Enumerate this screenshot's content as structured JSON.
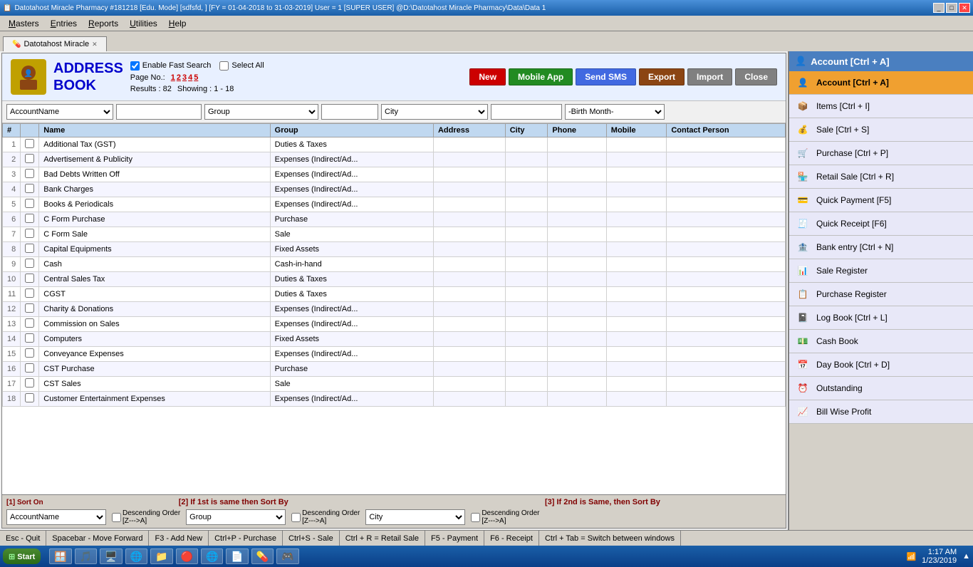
{
  "titlebar": {
    "title": "Datotahost Miracle Pharmacy #181218  [Edu. Mode]  [sdfsfd, ]  [FY = 01-04-2018 to 31-03-2019]  User = 1 [SUPER USER]  @D:\\Datotahost Miracle Pharmacy\\Data\\Data 1"
  },
  "menubar": {
    "items": [
      "Masters",
      "Entries",
      "Reports",
      "Utilities",
      "Help"
    ]
  },
  "tab": {
    "label": "Datotahost Miracle"
  },
  "addressbook": {
    "title_line1": "ADDRESS",
    "title_line2": "BOOK",
    "enable_fast_search": "Enable Fast Search",
    "select_all": "Select All",
    "page_no_label": "Page No.:",
    "pages": [
      "1",
      "2",
      "3",
      "4",
      "5"
    ],
    "results_label": "Results : 82",
    "showing_label": "Showing :  1 - 18",
    "buttons": {
      "new": "New",
      "mobile_app": "Mobile App",
      "send_sms": "Send SMS",
      "export": "Export",
      "import": "Import",
      "close": "Close"
    },
    "filters": {
      "account_name": "AccountName",
      "group": "Group",
      "city": "City",
      "birth_month": "-Birth Month-"
    },
    "columns": [
      "Name",
      "Group",
      "Address",
      "City",
      "Phone",
      "Mobile",
      "Contact Person"
    ],
    "rows": [
      {
        "num": "1",
        "name": "Additional Tax (GST)",
        "group": "Duties & Taxes",
        "address": "",
        "city": "",
        "phone": "",
        "mobile": "",
        "contact": ""
      },
      {
        "num": "2",
        "name": "Advertisement & Publicity",
        "group": "Expenses (Indirect/Ad...",
        "address": "",
        "city": "",
        "phone": "",
        "mobile": "",
        "contact": ""
      },
      {
        "num": "3",
        "name": "Bad Debts Written Off",
        "group": "Expenses (Indirect/Ad...",
        "address": "",
        "city": "",
        "phone": "",
        "mobile": "",
        "contact": ""
      },
      {
        "num": "4",
        "name": "Bank Charges",
        "group": "Expenses (Indirect/Ad...",
        "address": "",
        "city": "",
        "phone": "",
        "mobile": "",
        "contact": ""
      },
      {
        "num": "5",
        "name": "Books & Periodicals",
        "group": "Expenses (Indirect/Ad...",
        "address": "",
        "city": "",
        "phone": "",
        "mobile": "",
        "contact": ""
      },
      {
        "num": "6",
        "name": "C Form Purchase",
        "group": "Purchase",
        "address": "",
        "city": "",
        "phone": "",
        "mobile": "",
        "contact": ""
      },
      {
        "num": "7",
        "name": "C Form Sale",
        "group": "Sale",
        "address": "",
        "city": "",
        "phone": "",
        "mobile": "",
        "contact": ""
      },
      {
        "num": "8",
        "name": "Capital Equipments",
        "group": "Fixed Assets",
        "address": "",
        "city": "",
        "phone": "",
        "mobile": "",
        "contact": ""
      },
      {
        "num": "9",
        "name": "Cash",
        "group": "Cash-in-hand",
        "address": "",
        "city": "",
        "phone": "",
        "mobile": "",
        "contact": ""
      },
      {
        "num": "10",
        "name": "Central Sales Tax",
        "group": "Duties & Taxes",
        "address": "",
        "city": "",
        "phone": "",
        "mobile": "",
        "contact": ""
      },
      {
        "num": "11",
        "name": "CGST",
        "group": "Duties & Taxes",
        "address": "",
        "city": "",
        "phone": "",
        "mobile": "",
        "contact": ""
      },
      {
        "num": "12",
        "name": "Charity & Donations",
        "group": "Expenses (Indirect/Ad...",
        "address": "",
        "city": "",
        "phone": "",
        "mobile": "",
        "contact": ""
      },
      {
        "num": "13",
        "name": "Commission on Sales",
        "group": "Expenses (Indirect/Ad...",
        "address": "",
        "city": "",
        "phone": "",
        "mobile": "",
        "contact": ""
      },
      {
        "num": "14",
        "name": "Computers",
        "group": "Fixed Assets",
        "address": "",
        "city": "",
        "phone": "",
        "mobile": "",
        "contact": ""
      },
      {
        "num": "15",
        "name": "Conveyance Expenses",
        "group": "Expenses (Indirect/Ad...",
        "address": "",
        "city": "",
        "phone": "",
        "mobile": "",
        "contact": ""
      },
      {
        "num": "16",
        "name": "CST Purchase",
        "group": "Purchase",
        "address": "",
        "city": "",
        "phone": "",
        "mobile": "",
        "contact": ""
      },
      {
        "num": "17",
        "name": "CST Sales",
        "group": "Sale",
        "address": "",
        "city": "",
        "phone": "",
        "mobile": "",
        "contact": ""
      },
      {
        "num": "18",
        "name": "Customer Entertainment Expenses",
        "group": "Expenses (Indirect/Ad...",
        "address": "",
        "city": "",
        "phone": "",
        "mobile": "",
        "contact": ""
      }
    ]
  },
  "sort_bar": {
    "section1_label": "[1] Sort On",
    "section2_label": "[2] If 1st is same then Sort By",
    "section3_label": "[3] If 2nd is Same, then Sort By",
    "sort1_value": "AccountName",
    "sort2_value": "Group",
    "sort3_value": "City",
    "descending_label": "Descending Order [Z--->A]"
  },
  "statusbar": {
    "items": [
      "Esc - Quit",
      "Spacebar - Move Forward",
      "F3 - Add New",
      "Ctrl+P - Purchase",
      "Ctrl+S - Sale",
      "Ctrl + R = Retail Sale",
      "F5 - Payment",
      "F6 - Receipt",
      "Ctrl + Tab = Switch between windows"
    ]
  },
  "sidebar": {
    "header": "Account [Ctrl + A]",
    "items": [
      {
        "label": "Account [Ctrl + A]",
        "active": true,
        "icon": "account-icon"
      },
      {
        "label": "Items [Ctrl + I]",
        "active": false,
        "icon": "items-icon"
      },
      {
        "label": "Sale [Ctrl + S]",
        "active": false,
        "icon": "sale-icon"
      },
      {
        "label": "Purchase [Ctrl + P]",
        "active": false,
        "icon": "purchase-icon"
      },
      {
        "label": "Retail Sale [Ctrl + R]",
        "active": false,
        "icon": "retail-icon"
      },
      {
        "label": "Quick Payment [F5]",
        "active": false,
        "icon": "payment-icon"
      },
      {
        "label": "Quick Receipt [F6]",
        "active": false,
        "icon": "receipt-icon"
      },
      {
        "label": "Bank entry [Ctrl + N]",
        "active": false,
        "icon": "bank-icon"
      },
      {
        "label": "Sale Register",
        "active": false,
        "icon": "sale-register-icon"
      },
      {
        "label": "Purchase Register",
        "active": false,
        "icon": "purchase-register-icon"
      },
      {
        "label": "Log Book [Ctrl + L]",
        "active": false,
        "icon": "log-icon"
      },
      {
        "label": "Cash Book",
        "active": false,
        "icon": "cash-icon"
      },
      {
        "label": "Day Book [Ctrl + D]",
        "active": false,
        "icon": "day-icon"
      },
      {
        "label": "Outstanding",
        "active": false,
        "icon": "outstanding-icon"
      },
      {
        "label": "Bill Wise Profit",
        "active": false,
        "icon": "profit-icon"
      }
    ]
  },
  "taskbar": {
    "start_label": "Start",
    "apps": [
      "datotahost"
    ],
    "time": "1:17 AM",
    "date": "1/23/2019"
  }
}
